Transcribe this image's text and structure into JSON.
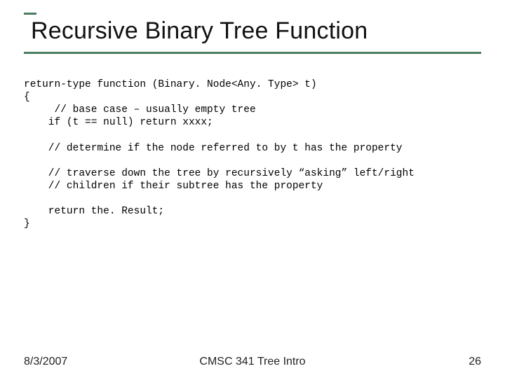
{
  "title": "Recursive Binary Tree Function",
  "code": {
    "l1": "return-type function (Binary. Node<Any. Type> t)",
    "l2": "{",
    "l3": "     // base case – usually empty tree",
    "l4": "    if (t == null) return xxxx;",
    "l5": "    // determine if the node referred to by t has the property",
    "l6": "    // traverse down the tree by recursively “asking” left/right",
    "l7": "    // children if their subtree has the property",
    "l8": "    return the. Result;",
    "l9": "}"
  },
  "footer": {
    "date": "8/3/2007",
    "center": "CMSC 341 Tree Intro",
    "page": "26"
  }
}
